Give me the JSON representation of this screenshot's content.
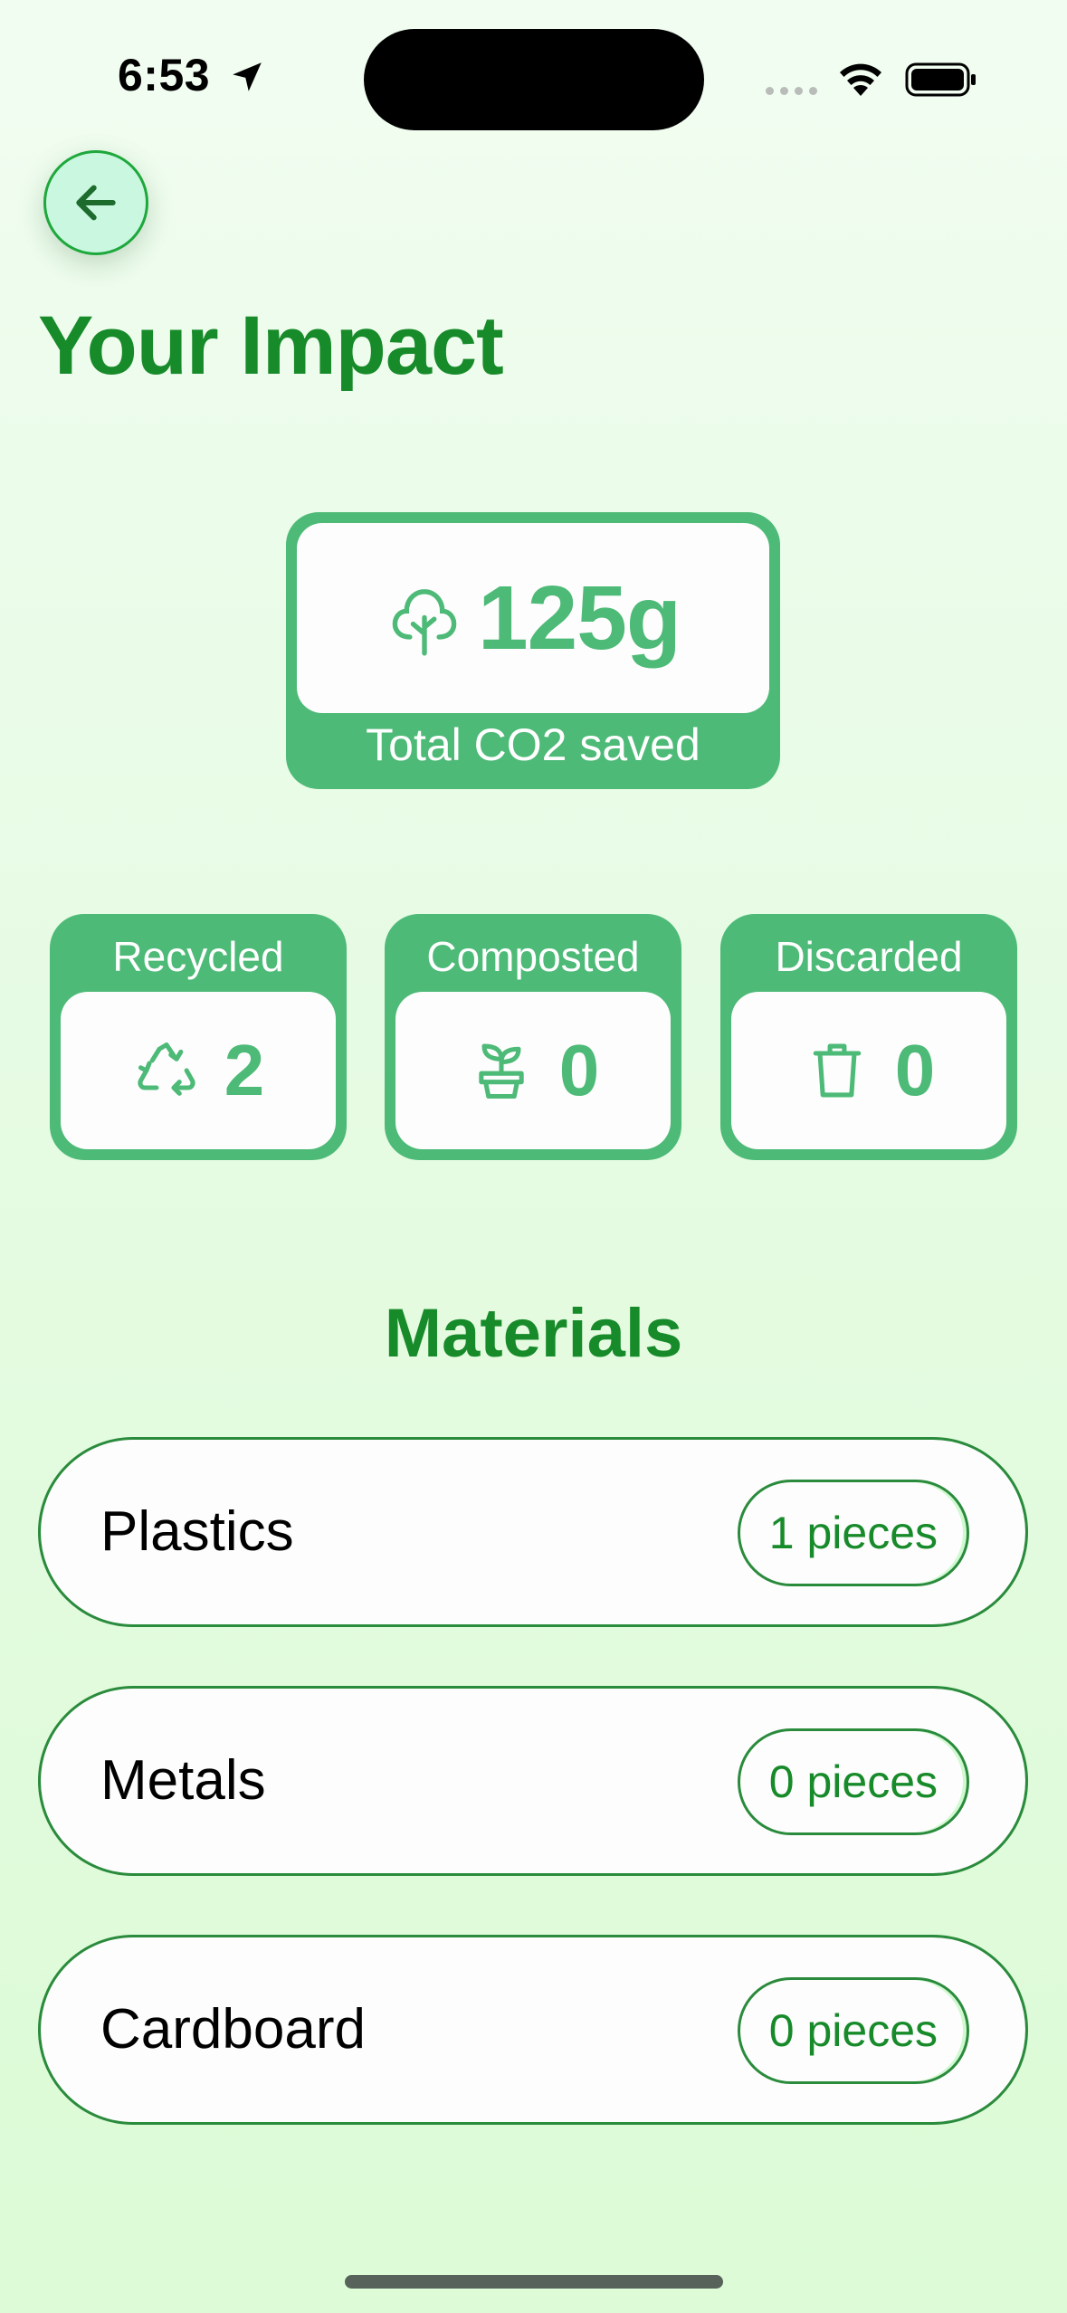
{
  "status_bar": {
    "time": "6:53",
    "icons": [
      "location-arrow-icon",
      "cellular-signal-icon",
      "wifi-icon",
      "battery-icon"
    ]
  },
  "header": {
    "back_icon": "arrow-left-icon",
    "title": "Your Impact"
  },
  "co2_card": {
    "icon": "tree-icon",
    "value": "125g",
    "label": "Total CO2 saved"
  },
  "stats": [
    {
      "label": "Recycled",
      "value": "2",
      "icon": "recycle-icon"
    },
    {
      "label": "Composted",
      "value": "0",
      "icon": "sprout-pot-icon"
    },
    {
      "label": "Discarded",
      "value": "0",
      "icon": "trash-icon"
    }
  ],
  "materials": {
    "title": "Materials",
    "items": [
      {
        "name": "Plastics",
        "count": "1 pieces"
      },
      {
        "name": "Metals",
        "count": "0 pieces"
      },
      {
        "name": "Cardboard",
        "count": "0 pieces"
      }
    ]
  },
  "colors": {
    "accent_green": "#4dba77",
    "title_green": "#178a2a",
    "border_green": "#2a8b3c",
    "background": "#e6fbe3"
  }
}
